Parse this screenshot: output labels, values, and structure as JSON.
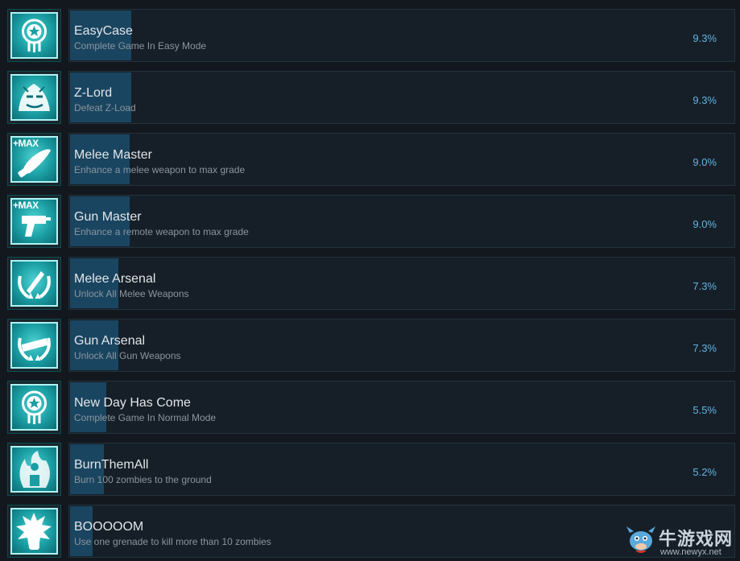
{
  "achievements": [
    {
      "name": "EasyCase",
      "description": "Complete Game In Easy Mode",
      "percent": "9.3%",
      "percent_value": 9.3,
      "icon": "medal-star-icon"
    },
    {
      "name": "Z-Lord",
      "description": "Defeat Z-Load",
      "percent": "9.3%",
      "percent_value": 9.3,
      "icon": "zombie-boss-icon"
    },
    {
      "name": "Melee Master",
      "description": "Enhance a melee weapon to max grade",
      "percent": "9.0%",
      "percent_value": 9.0,
      "icon": "machete-max-icon",
      "badge": "+MAX"
    },
    {
      "name": "Gun Master",
      "description": "Enhance a remote weapon to max grade",
      "percent": "9.0%",
      "percent_value": 9.0,
      "icon": "pistol-max-icon",
      "badge": "+MAX"
    },
    {
      "name": "Melee Arsenal",
      "description": "Unlock All Melee Weapons",
      "percent": "7.3%",
      "percent_value": 7.3,
      "icon": "melee-laurel-icon"
    },
    {
      "name": "Gun Arsenal",
      "description": "Unlock All Gun Weapons",
      "percent": "7.3%",
      "percent_value": 7.3,
      "icon": "gun-laurel-icon"
    },
    {
      "name": "New Day Has Come",
      "description": "Complete Game In Normal Mode",
      "percent": "5.5%",
      "percent_value": 5.5,
      "icon": "medal-star-icon"
    },
    {
      "name": "BurnThemAll",
      "description": "Burn 100 zombies to the ground",
      "percent": "5.2%",
      "percent_value": 5.2,
      "icon": "fire-zombie-icon"
    },
    {
      "name": "BOOOOOM",
      "description": "Use one grenade to kill more than 10 zombies",
      "percent": "",
      "percent_value": 3.4,
      "icon": "explosion-fist-icon"
    }
  ],
  "watermark": {
    "name": "牛游戏网",
    "url": "www.newyx.net"
  },
  "colors": {
    "background": "#13181e",
    "progress_bar": "#1a4560",
    "percent_text": "#62b3e4",
    "icon_teal": "#1a9ea3"
  }
}
